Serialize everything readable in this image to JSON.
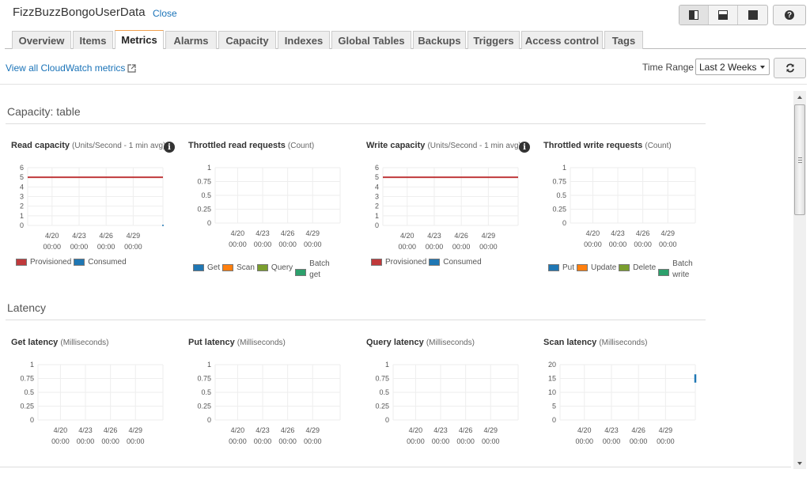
{
  "header": {
    "title": "FizzBuzzBongoUserData",
    "close_label": "Close"
  },
  "layout_buttons": [
    {
      "name": "split-right-view-icon"
    },
    {
      "name": "split-bottom-view-icon"
    },
    {
      "name": "full-view-icon"
    }
  ],
  "help_label": "?",
  "tabs": [
    {
      "label": "Overview",
      "active": false
    },
    {
      "label": "Items",
      "active": false
    },
    {
      "label": "Metrics",
      "active": true
    },
    {
      "label": "Alarms",
      "active": false
    },
    {
      "label": "Capacity",
      "active": false
    },
    {
      "label": "Indexes",
      "active": false
    },
    {
      "label": "Global Tables",
      "active": false
    },
    {
      "label": "Backups",
      "active": false
    },
    {
      "label": "Triggers",
      "active": false
    },
    {
      "label": "Access control",
      "active": false
    },
    {
      "label": "Tags",
      "active": false
    }
  ],
  "toolbar": {
    "cloudwatch_link": "View all CloudWatch metrics",
    "time_range_label": "Time Range",
    "time_range_value": "Last 2 Weeks"
  },
  "sections": {
    "capacity": "Capacity: table",
    "latency": "Latency"
  },
  "colors": {
    "provisioned": "#c0393b",
    "consumed": "#1f77b4",
    "get": "#1f77b4",
    "scan": "#ff7f0e",
    "query": "#7a9e2e",
    "batch": "#2ca06c",
    "link": "#1a73b8",
    "tab_active_border": "#f0a050"
  },
  "chart_data": [
    {
      "type": "line",
      "title": "Read capacity",
      "unit": "(Units/Second - 1 min avg)",
      "has_info": true,
      "yticks": [
        "0",
        "1",
        "2",
        "3",
        "4",
        "5",
        "6"
      ],
      "ylim": [
        0,
        6
      ],
      "xticks": [
        "4/20",
        "4/23",
        "4/26",
        "4/29"
      ],
      "xticks_time": "00:00",
      "series": [
        {
          "name": "Provisioned",
          "color": "#c0393b",
          "values": [
            [
              0,
              5
            ],
            [
              1,
              5
            ]
          ]
        },
        {
          "name": "Consumed",
          "color": "#1f77b4",
          "values": [
            [
              1,
              0
            ]
          ]
        }
      ],
      "legend": [
        "Provisioned",
        "Consumed"
      ]
    },
    {
      "type": "line",
      "title": "Throttled read requests",
      "unit": "(Count)",
      "has_info": false,
      "yticks": [
        "0",
        "0.25",
        "0.5",
        "0.75",
        "1"
      ],
      "ylim": [
        0,
        1
      ],
      "xticks": [
        "4/20",
        "4/23",
        "4/26",
        "4/29"
      ],
      "xticks_time": "00:00",
      "series": [],
      "legend": [
        "Get",
        "Scan",
        "Query",
        "Batch get"
      ]
    },
    {
      "type": "line",
      "title": "Write capacity",
      "unit": "(Units/Second - 1 min avg)",
      "has_info": true,
      "yticks": [
        "0",
        "1",
        "2",
        "3",
        "4",
        "5",
        "6"
      ],
      "ylim": [
        0,
        6
      ],
      "xticks": [
        "4/20",
        "4/23",
        "4/26",
        "4/29"
      ],
      "xticks_time": "00:00",
      "series": [
        {
          "name": "Provisioned",
          "color": "#c0393b",
          "values": [
            [
              0,
              5
            ],
            [
              1,
              5
            ]
          ]
        }
      ],
      "legend": [
        "Provisioned",
        "Consumed"
      ]
    },
    {
      "type": "line",
      "title": "Throttled write requests",
      "unit": "(Count)",
      "has_info": false,
      "yticks": [
        "0",
        "0.25",
        "0.5",
        "0.75",
        "1"
      ],
      "ylim": [
        0,
        1
      ],
      "xticks": [
        "4/20",
        "4/23",
        "4/26",
        "4/29"
      ],
      "xticks_time": "00:00",
      "series": [],
      "legend": [
        "Put",
        "Update",
        "Delete",
        "Batch write"
      ]
    },
    {
      "type": "line",
      "title": "Get latency",
      "unit": "(Milliseconds)",
      "has_info": false,
      "yticks": [
        "0",
        "0.25",
        "0.5",
        "0.75",
        "1"
      ],
      "ylim": [
        0,
        1
      ],
      "xticks": [
        "4/20",
        "4/23",
        "4/26",
        "4/29"
      ],
      "xticks_time": "00:00",
      "series": [],
      "legend": []
    },
    {
      "type": "line",
      "title": "Put latency",
      "unit": "(Milliseconds)",
      "has_info": false,
      "yticks": [
        "0",
        "0.25",
        "0.5",
        "0.75",
        "1"
      ],
      "ylim": [
        0,
        1
      ],
      "xticks": [
        "4/20",
        "4/23",
        "4/26",
        "4/29"
      ],
      "xticks_time": "00:00",
      "series": [],
      "legend": []
    },
    {
      "type": "line",
      "title": "Query latency",
      "unit": "(Milliseconds)",
      "has_info": false,
      "yticks": [
        "0",
        "0.25",
        "0.5",
        "0.75",
        "1"
      ],
      "ylim": [
        0,
        1
      ],
      "xticks": [
        "4/20",
        "4/23",
        "4/26",
        "4/29"
      ],
      "xticks_time": "00:00",
      "series": [],
      "legend": []
    },
    {
      "type": "line",
      "title": "Scan latency",
      "unit": "(Milliseconds)",
      "has_info": false,
      "yticks": [
        "0",
        "5",
        "10",
        "15",
        "20"
      ],
      "ylim": [
        0,
        20
      ],
      "xticks": [
        "4/20",
        "4/23",
        "4/26",
        "4/29"
      ],
      "xticks_time": "00:00",
      "series": [
        {
          "name": "Scan",
          "color": "#1f77b4",
          "values": [
            [
              1,
              13.5
            ],
            [
              1,
              16.5
            ]
          ]
        }
      ],
      "legend": []
    }
  ]
}
